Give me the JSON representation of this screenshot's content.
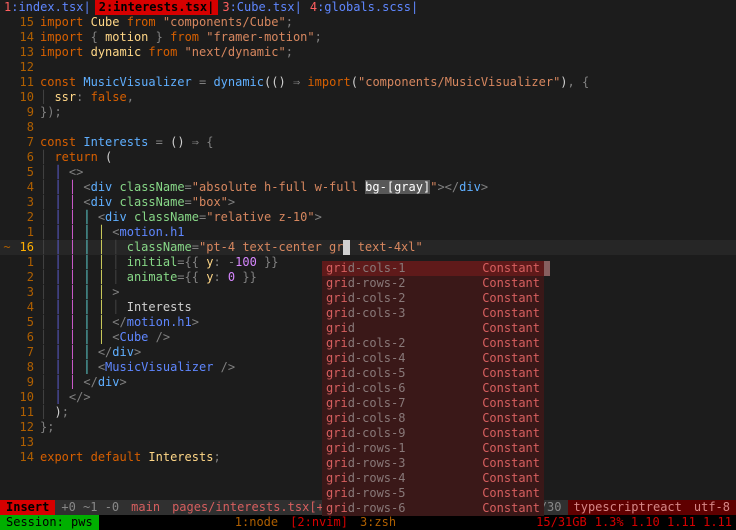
{
  "tabs": [
    {
      "num": "1",
      "name": ":index.tsx"
    },
    {
      "num": "2",
      "name": ":interests.tsx"
    },
    {
      "num": "3",
      "name": ":Cube.tsx"
    },
    {
      "num": "4",
      "name": ":globals.scss"
    }
  ],
  "gutter": {
    "l0": "15",
    "l1": "14",
    "l2": "13",
    "l3": "12",
    "l4": "11",
    "l5": "10",
    "l6": "9",
    "l7": "8",
    "l8": "7",
    "l9": "6",
    "l10": "5",
    "l11": "4",
    "l12": "3",
    "l13": "2",
    "l14": "1",
    "l15": "16",
    "l16": "1",
    "l17": "2",
    "l18": "3",
    "l19": "4",
    "l20": "5",
    "l21": "6",
    "l22": "7",
    "l23": "8",
    "l24": "9",
    "l25": "10",
    "l26": "11",
    "l27": "12",
    "l28": "13",
    "l29": "14"
  },
  "sign": "~",
  "code": {
    "kw_import": "import",
    "kw_from": "from",
    "kw_const": "const",
    "kw_false": "false",
    "kw_return": "return",
    "kw_export": "export",
    "kw_default": "default",
    "id_Cube": "Cube",
    "id_motion": "motion",
    "id_dynamic": "dynamic",
    "id_MusicVisualizer": "MusicVisualizer",
    "id_Interests": "Interests",
    "id_ssr": "ssr",
    "str_cube": "\"components/Cube\"",
    "str_framer": "\"framer-motion\"",
    "str_dynamic": "\"next/dynamic\"",
    "str_mv": "\"components/MusicVisualizer\"",
    "attr_className": "className",
    "attr_initial": "initial",
    "attr_animate": "animate",
    "str_abs": "\"absolute h-full w-full ",
    "str_bg": "bg-[gray]",
    "str_abs_end": "\"",
    "str_box": "\"box\"",
    "str_rel": "\"relative z-10\"",
    "str_pt4": "\"pt-4 text-center gr",
    "str_textxl": " text-4xl\"",
    "y_key": "y",
    "n100": "100",
    "n0": "0",
    "tag_div": "div",
    "tag_motionh1": "motion.h1",
    "txt_Interests": "Interests",
    "arrow": "=>",
    "rocket": "⇒"
  },
  "popup": {
    "sel": "grid-cols-1",
    "items": [
      "grid-cols-1",
      "grid-rows-2",
      "grid-cols-2",
      "grid-cols-3",
      "grid",
      "grid-cols-2",
      "grid-cols-4",
      "grid-cols-5",
      "grid-cols-6",
      "grid-cols-7",
      "grid-cols-8",
      "grid-cols-9",
      "grid-rows-1",
      "grid-rows-3",
      "grid-rows-4",
      "grid-rows-5",
      "grid-rows-6"
    ],
    "kind": "Constant"
  },
  "statusline": {
    "mode": "Insert",
    "changes": "+0 ~1 -0",
    "branch": "main",
    "file": "pages/interests.tsx[+]",
    "pct": "/30",
    "ft": "typescriptreact",
    "enc": "utf-8"
  },
  "tmux": {
    "session": "Session: pws",
    "win1": "1:node",
    "win2": "[2:nvim]",
    "win3": "3:zsh",
    "mem": "15/31GB",
    "load": "1.3% 1.10 1.11 1.11"
  }
}
